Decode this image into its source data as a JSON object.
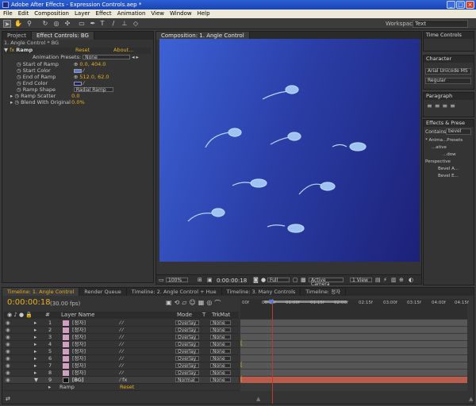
{
  "app": {
    "title": "Adobe After Effects - Expression Controls.aep *"
  },
  "menu": [
    "File",
    "Edit",
    "Composition",
    "Layer",
    "Effect",
    "Animation",
    "View",
    "Window",
    "Help"
  ],
  "toolbar": {
    "workspace_label": "Workspace:",
    "workspace_value": "Text"
  },
  "left_panel": {
    "tabs": [
      "Project",
      "Effect Controls: BG"
    ],
    "breadcrumb": "1. Angle Control * BG",
    "effect": {
      "name": "Ramp",
      "reset": "Reset",
      "about": "About..."
    },
    "presets_label": "Animation Presets:",
    "presets_value": "None",
    "props": [
      {
        "label": "Start of Ramp",
        "value": "0.0, 404.0"
      },
      {
        "label": "Start Color",
        "value": ""
      },
      {
        "label": "End of Ramp",
        "value": "512.0, 62.0"
      },
      {
        "label": "End Color",
        "value": ""
      },
      {
        "label": "Ramp Shape",
        "value": "Radial Ramp"
      },
      {
        "label": "Ramp Scatter",
        "value": "0.0"
      },
      {
        "label": "Blend With Original",
        "value": "0.0%"
      }
    ]
  },
  "comp": {
    "tab": "Composition: 1. Angle Control",
    "zoom": "100%",
    "time": "0:00:00:18",
    "resolution": "Full",
    "camera": "Active Camera",
    "view": "1 View"
  },
  "right": {
    "time_controls": "Time Controls",
    "character": "Character",
    "font": "Arial Unicode MS",
    "style": "Regular",
    "paragraph": "Paragraph",
    "effects_presets": "Effects & Prese",
    "contains_label": "Contains:",
    "contains_value": "bevel",
    "tree": [
      "* Anima...Presets",
      "...ative",
      "...dow",
      "Perspective",
      "Bevel A...",
      "Bevel E..."
    ]
  },
  "timeline": {
    "tabs": [
      "Timeline: 1. Angle Control",
      "Render Queue",
      "Timeline: 2. Angle Control + Hue",
      "Timeline: 3. Many Controls",
      "Timeline: 정자"
    ],
    "timecode": "0:00:00:18",
    "fps": "(30.00 fps)",
    "ruler": [
      "00f",
      "00:15f",
      "01:00f",
      "01:15f",
      "02:00f",
      "02:15f",
      "03:00f",
      "03:15f",
      "04:00f",
      "04:15f"
    ],
    "columns": {
      "num": "#",
      "name": "Layer Name",
      "mode": "Mode",
      "t": "T",
      "trkmat": "TrkMat"
    },
    "layers": [
      {
        "num": "1",
        "name": "[정자]",
        "mode": "Overlay",
        "trkmat": "None"
      },
      {
        "num": "2",
        "name": "[정자]",
        "mode": "Overlay",
        "trkmat": "None"
      },
      {
        "num": "3",
        "name": "[정자]",
        "mode": "Overlay",
        "trkmat": "None"
      },
      {
        "num": "4",
        "name": "[정자]",
        "mode": "Overlay",
        "trkmat": "None"
      },
      {
        "num": "5",
        "name": "[정자]",
        "mode": "Overlay",
        "trkmat": "None"
      },
      {
        "num": "6",
        "name": "[정자]",
        "mode": "Overlay",
        "trkmat": "None"
      },
      {
        "num": "7",
        "name": "[정자]",
        "mode": "Overlay",
        "trkmat": "None"
      },
      {
        "num": "8",
        "name": "[정자]",
        "mode": "Overlay",
        "trkmat": "None"
      },
      {
        "num": "9",
        "name": "[BG]",
        "mode": "Normal",
        "trkmat": "None"
      }
    ],
    "effect_row": {
      "name": "Ramp",
      "reset": "Reset"
    }
  },
  "colors": {
    "start_color": "#5a7ad8",
    "end_color": "#1a1f70",
    "accent": "#e8b01a",
    "bg_track": "#b95c4c"
  }
}
